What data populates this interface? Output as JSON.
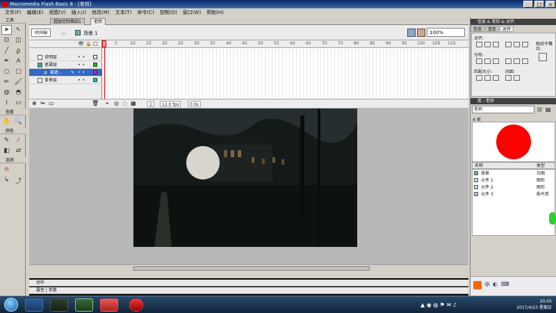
{
  "window": {
    "title": "Macromedia Flash Basic 8 - [老师]",
    "controls": [
      "_",
      "□",
      "×"
    ]
  },
  "menu": [
    "文件(F)",
    "编辑(E)",
    "视图(V)",
    "插入(I)",
    "修改(M)",
    "文本(T)",
    "命令(C)",
    "控制(O)",
    "窗口(W)",
    "帮助(H)"
  ],
  "toolbox": {
    "title": "工具",
    "view_label": "查看",
    "colors_label": "颜色",
    "options_label": "选项"
  },
  "document_tabs": [
    "超级控制第四1",
    "老师"
  ],
  "editbar": {
    "timeline_button": "时间轴",
    "scene": "场景 1",
    "zoom": "100%"
  },
  "timeline": {
    "ruler": [
      "5",
      "10",
      "15",
      "20",
      "25",
      "30",
      "35",
      "40",
      "45",
      "50",
      "55",
      "60",
      "65",
      "70",
      "75",
      "80",
      "85",
      "90",
      "95",
      "100",
      "105",
      "110"
    ],
    "layers": [
      {
        "name": "说明层",
        "selected": false
      },
      {
        "name": "遮罩层",
        "selected": false
      },
      {
        "name": "被遮...",
        "selected": true
      },
      {
        "name": "背景层",
        "selected": false
      }
    ],
    "current_frame": "1",
    "fps": "12.0 fps",
    "elapsed": "0.0s"
  },
  "bottom_panels": [
    "动作",
    "属性 | 参数"
  ],
  "right_panel": {
    "info_title": "信息 & 变形 & 对齐",
    "info_tabs": [
      "信息",
      "变形",
      "对齐"
    ],
    "align_label": "对齐:",
    "distribute_label": "分布:",
    "match_size_label": "匹配大小:",
    "spacing_label": "间距:",
    "relative_label": "相对于舞台:",
    "library_title": "库 - 老师",
    "library_doc": "老师",
    "item_count": "4 项",
    "columns": [
      "名称",
      "类型"
    ],
    "items": [
      {
        "name": "夜景",
        "type": "位图"
      },
      {
        "name": "元件 1",
        "type": "图形"
      },
      {
        "name": "元件 2",
        "type": "图形"
      },
      {
        "name": "元件 3",
        "type": "影片剪"
      }
    ]
  },
  "taskbar": {
    "time": "20:05",
    "date": "2017/4/23 星期日"
  },
  "colors": {
    "mask_circle": "#e6e3dc",
    "library_preview_circle": "#ff0000",
    "selected_layer": "#316ac5"
  }
}
